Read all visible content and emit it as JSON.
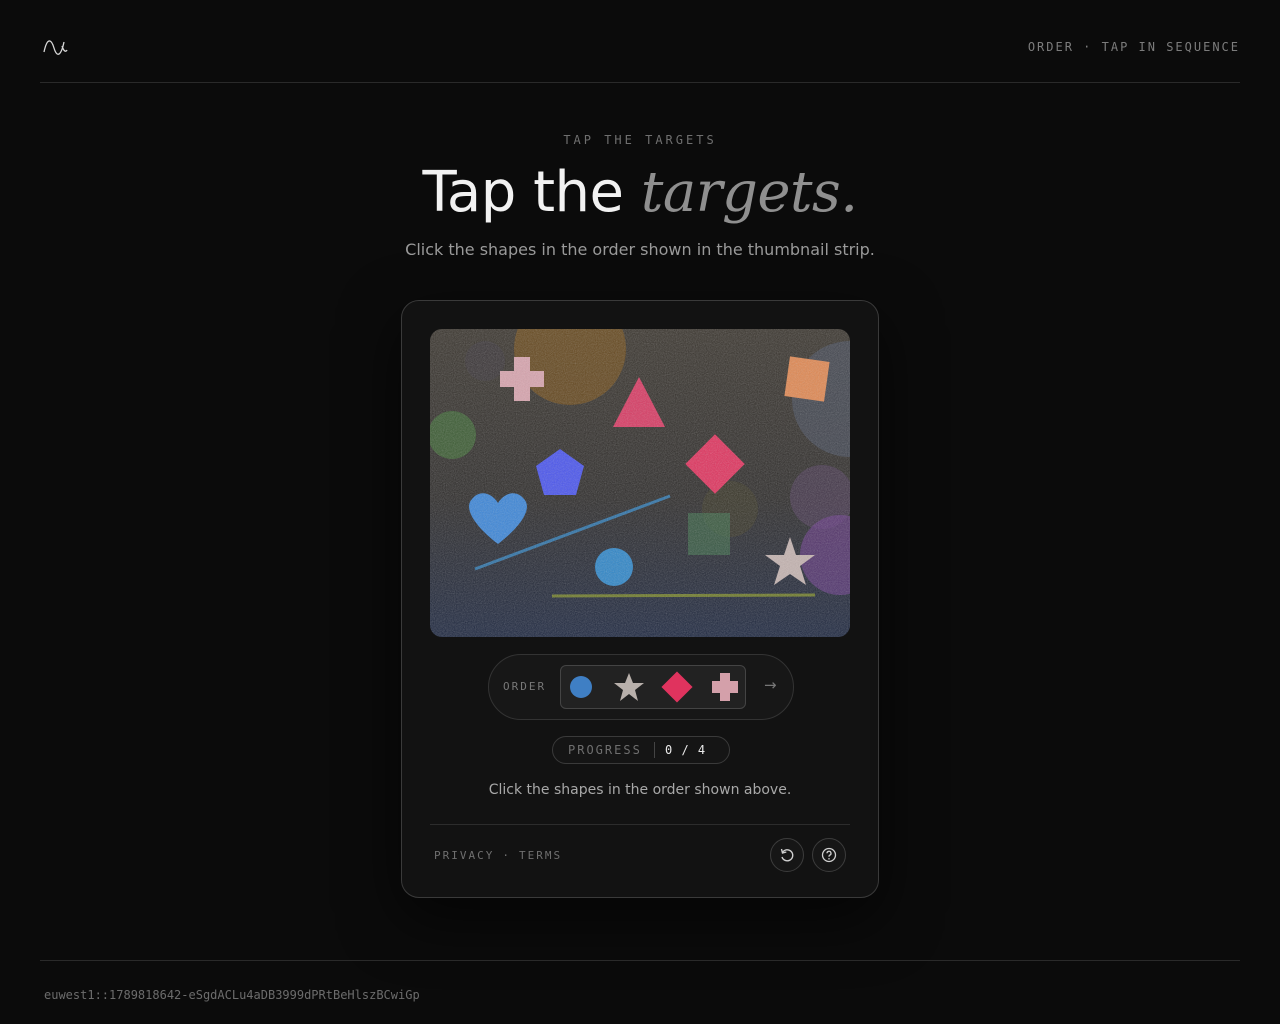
{
  "header": {
    "logo_icon": "wave-icon",
    "right_text": "ORDER · TAP IN SEQUENCE"
  },
  "hero": {
    "eyebrow": "TAP THE TARGETS",
    "title_plain": "Tap the",
    "title_emphasis": "targets.",
    "subtitle": "Click the shapes in the order shown in the thumbnail strip."
  },
  "challenge": {
    "canvas_shapes": [
      "cross",
      "triangle",
      "square",
      "circle",
      "pentagon",
      "diamond",
      "heart",
      "circle",
      "square",
      "star"
    ],
    "order_label": "ORDER",
    "order_sequence": [
      {
        "shape": "circle",
        "color": "#3f7fc4"
      },
      {
        "shape": "star",
        "color": "#b8b0ab"
      },
      {
        "shape": "diamond",
        "color": "#e0335e"
      },
      {
        "shape": "cross",
        "color": "#d4a0aa"
      }
    ],
    "next_icon": "arrow-right-icon",
    "progress_label": "PROGRESS",
    "progress_value": "0 / 4",
    "instruction": "Click the shapes in the order shown above."
  },
  "card_footer": {
    "privacy": "PRIVACY",
    "separator": "·",
    "terms": "TERMS",
    "refresh_icon": "refresh-icon",
    "help_icon": "help-icon"
  },
  "footer": {
    "code": "euwest1::1789818642-eSgdACLu4aDB3999dPRtBeHlszBCwiGp"
  },
  "colors": {
    "background": "#0b0b0b",
    "card": "#121212",
    "accent_pink": "#e0335e",
    "accent_blue": "#3f7fc4"
  }
}
